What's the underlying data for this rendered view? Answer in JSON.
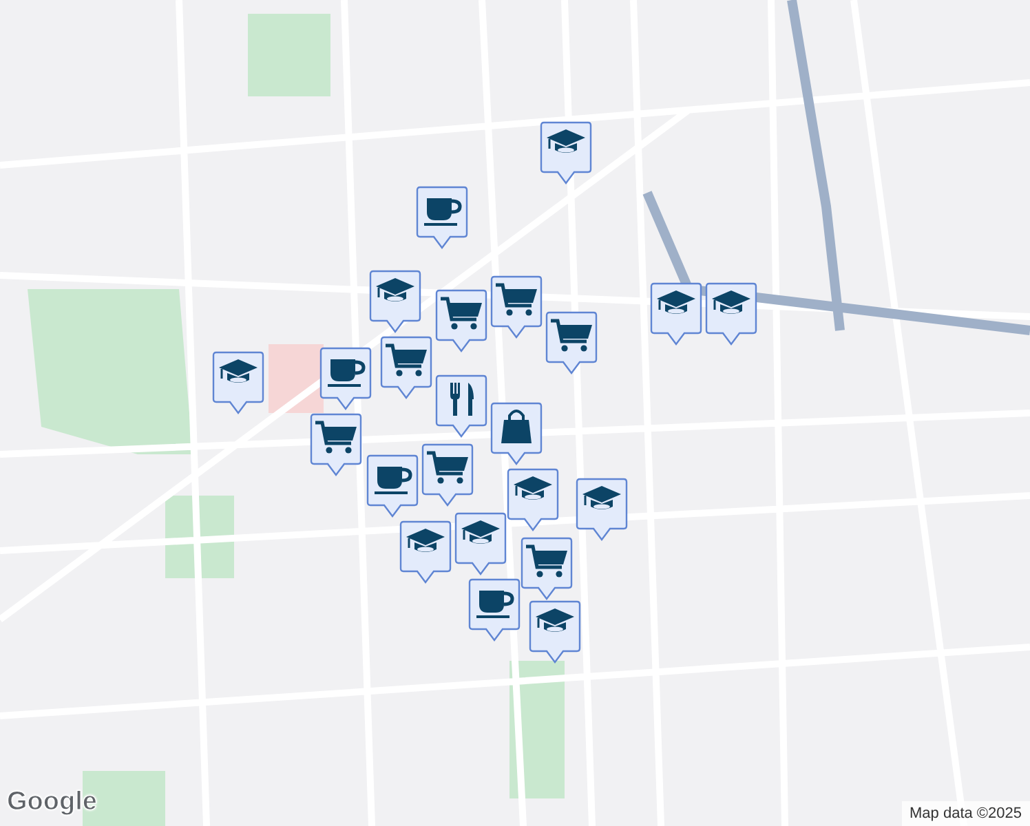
{
  "map": {
    "markers": [
      {
        "kind": "school"
      },
      {
        "kind": "coffee"
      },
      {
        "kind": "school"
      },
      {
        "kind": "school"
      },
      {
        "kind": "cart"
      },
      {
        "kind": "cart"
      },
      {
        "kind": "cart"
      },
      {
        "kind": "school"
      },
      {
        "kind": "school"
      },
      {
        "kind": "cart"
      },
      {
        "kind": "coffee"
      },
      {
        "kind": "restaurant"
      },
      {
        "kind": "cart"
      },
      {
        "kind": "bag"
      },
      {
        "kind": "coffee"
      },
      {
        "kind": "cart"
      },
      {
        "kind": "school"
      },
      {
        "kind": "school"
      },
      {
        "kind": "school"
      },
      {
        "kind": "school"
      },
      {
        "kind": "coffee"
      },
      {
        "kind": "cart"
      },
      {
        "kind": "school"
      }
    ]
  },
  "logo": "Google",
  "attribution": "Map data ©2025"
}
